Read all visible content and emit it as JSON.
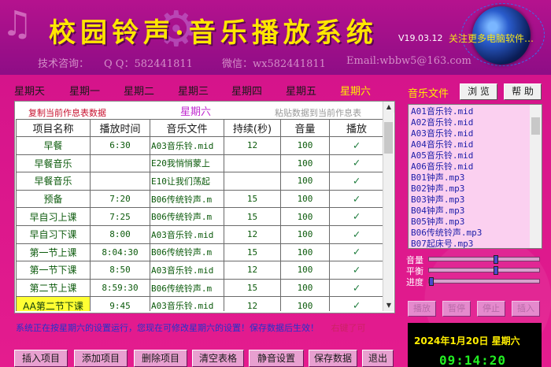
{
  "header": {
    "title": "校园铃声·音乐播放系统",
    "version": "V19.03.12",
    "slogan": "关注更多电脑软件…",
    "contact": {
      "tech": "技术咨询：",
      "qq": "Q Q：582441811",
      "wechat": "微信：wx582441811",
      "email": "Email:wbbw5@163.com"
    }
  },
  "week_tabs": [
    "星期天",
    "星期一",
    "星期二",
    "星期三",
    "星期四",
    "星期五",
    "星期六"
  ],
  "active_day_index": 6,
  "schedule": {
    "copy_label": "复制当前作息表数据",
    "current_day": "星期六",
    "paste_label": "粘贴数据到当前作息表",
    "columns": [
      "项目名称",
      "播放时间",
      "音乐文件",
      "持续(秒)",
      "音量",
      "播放"
    ],
    "rows": [
      {
        "name": "早餐",
        "time": "6:30",
        "file": "A03音乐铃.mid",
        "duration": "12",
        "volume": "100",
        "play": "✓"
      },
      {
        "name": "早餐音乐",
        "time": "",
        "file": "E20我悄悄蒙上",
        "duration": "",
        "volume": "100",
        "play": "✓"
      },
      {
        "name": "早餐音乐",
        "time": "",
        "file": "E10让我们荡起",
        "duration": "",
        "volume": "100",
        "play": "✓"
      },
      {
        "name": "预备",
        "time": "7:20",
        "file": "B06传统铃声.m",
        "duration": "15",
        "volume": "100",
        "play": "✓"
      },
      {
        "name": "早自习上课",
        "time": "7:25",
        "file": "B06传统铃声.m",
        "duration": "15",
        "volume": "100",
        "play": "✓"
      },
      {
        "name": "早自习下课",
        "time": "8:00",
        "file": "A03音乐铃.mid",
        "duration": "12",
        "volume": "100",
        "play": "✓"
      },
      {
        "name": "第一节上课",
        "time": "8:04:30",
        "file": "B06传统铃声.m",
        "duration": "15",
        "volume": "100",
        "play": "✓"
      },
      {
        "name": "第一节下课",
        "time": "8:50",
        "file": "A03音乐铃.mid",
        "duration": "12",
        "volume": "100",
        "play": "✓"
      },
      {
        "name": "第二节上课",
        "time": "8:59:30",
        "file": "B06传统铃声.m",
        "duration": "15",
        "volume": "100",
        "play": "✓"
      },
      {
        "name": "AA第二节下课",
        "time": "9:45",
        "file": "A03音乐铃.mid",
        "duration": "12",
        "volume": "100",
        "play": "✓"
      }
    ],
    "highlight_row_index": 9
  },
  "status": {
    "message": "系统正在按星期六的设置运行，您现在可修改星期六的设置！保存数据后生效！",
    "hint": "右键了可"
  },
  "buttons": [
    "插入项目",
    "添加项目",
    "删除项目",
    "清空表格",
    "静音设置",
    "保存数据",
    "退出"
  ],
  "music_panel": {
    "label": "音乐文件",
    "browse": "浏 览",
    "help": "帮 助",
    "files": [
      "A01音乐铃.mid",
      "A02音乐铃.mid",
      "A03音乐铃.mid",
      "A04音乐铃.mid",
      "A05音乐铃.mid",
      "A06音乐铃.mid",
      "B01钟声.mp3",
      "B02钟声.mp3",
      "B03钟声.mp3",
      "B04钟声.mp3",
      "B05钟声.mp3",
      "B06传统铃声.mp3",
      "B07起床号.mp3"
    ],
    "sliders": [
      {
        "label": "音量",
        "value": 0.6
      },
      {
        "label": "平衡",
        "value": 0.6
      },
      {
        "label": "进度",
        "value": 0.0
      }
    ],
    "controls": [
      "播放",
      "暂停",
      "停止",
      "插入"
    ]
  },
  "clock": {
    "date": "2024年1月20日  星期六",
    "time": "09:14:20"
  },
  "colors": {
    "background": "#e11b8c",
    "title": "#ffe600",
    "active_tab": "#ffee00",
    "clock_time": "#22ee22"
  }
}
